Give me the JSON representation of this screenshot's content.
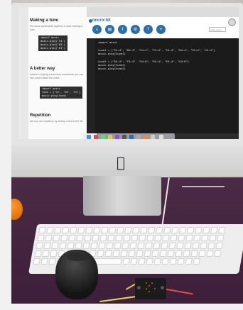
{
  "tutorial": {
    "heading1": "Making a tune",
    "paragraph1": "Put some commands together to start making a tune",
    "code1": [
      "import music",
      "",
      "music.play('C4')",
      "music.play('D4')",
      "music.play('E4')"
    ],
    "heading2": "A better way",
    "paragraph2": "Instead of typing out several commands you can use a list to store the notes",
    "code2": [
      "import music",
      "",
      "tune = ['C4', 'D4', 'E4']",
      "music.play(tune)"
    ],
    "heading3": "Repetition",
    "paragraph3": "We can use repetition by adding notes to the list"
  },
  "editor": {
    "brand": "micro:bit",
    "toolbar": [
      {
        "icon": "download-icon",
        "label": "Download"
      },
      {
        "icon": "save-icon",
        "label": "Save"
      },
      {
        "icon": "load-icon",
        "label": "Load"
      },
      {
        "icon": "snippets-icon",
        "label": "Snippets"
      },
      {
        "icon": "help-icon",
        "label": "Help"
      },
      {
        "icon": "zoom-icon",
        "label": "Zoom"
      }
    ],
    "script_name": "script name",
    "code_lines": [
      "import music",
      "",
      "tune1 = [\"C4:4\", \"D4:4\", \"E4:4\", \"C4:4\", \"C4:4\", \"D4:4\", \"E4:4\", \"C4:4\"]",
      "music.play(tune1)",
      "",
      "tune2 = [\"E4:4\", \"F4:4\", \"G4:8\", \"E4:4\", \"F4:4\", \"G4:8\"]",
      "music.play(tune2)",
      "music.play(tune2)"
    ]
  },
  "colors": {
    "brand_blue": "#2a6fa8",
    "desk_purple": "#3d1f3a",
    "led_red": "#ff3a2a"
  }
}
